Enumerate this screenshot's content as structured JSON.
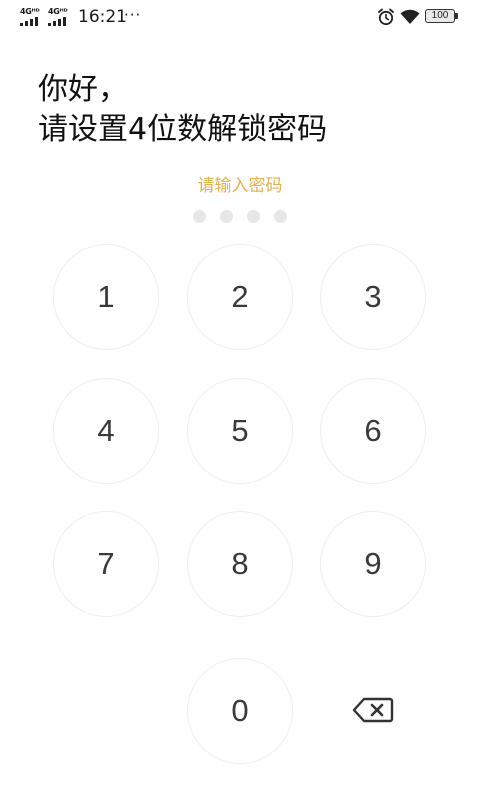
{
  "status_bar": {
    "sim1_network": "4Gᴴᴰ",
    "sim2_network": "4Gᴴᴰ",
    "time": "16:21",
    "more": "···",
    "battery_level": "100"
  },
  "heading": {
    "line1": "你好，",
    "line2": "请设置4位数解锁密码"
  },
  "prompt": "请输入密码",
  "pin_length": 4,
  "pin_entered": 0,
  "keypad": {
    "key_1": "1",
    "key_2": "2",
    "key_3": "3",
    "key_4": "4",
    "key_5": "5",
    "key_6": "6",
    "key_7": "7",
    "key_8": "8",
    "key_9": "9",
    "key_0": "0",
    "delete_icon": "backspace-icon"
  },
  "colors": {
    "prompt": "#e6b04b",
    "dot_empty": "#e7e7e7",
    "key_border": "#eeeeee",
    "key_text": "#3a3a3a"
  }
}
